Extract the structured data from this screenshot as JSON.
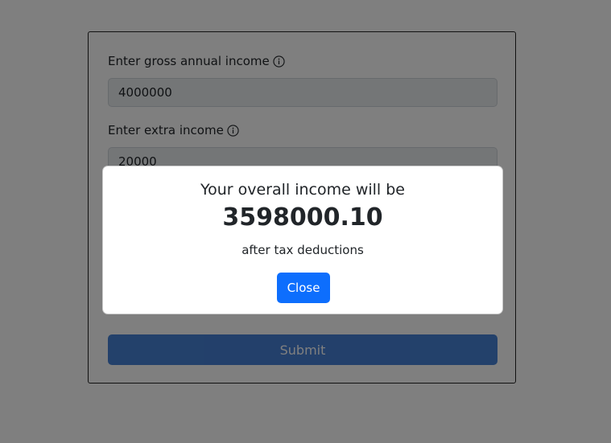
{
  "form": {
    "gross_income_label": "Enter gross annual income",
    "gross_income_value": "4000000",
    "extra_income_label": "Enter extra income",
    "extra_income_value": "20000",
    "submit_label": "Submit"
  },
  "modal": {
    "title": "Your overall income will be",
    "amount": "3598000.10",
    "subtitle": "after tax deductions",
    "close_label": "Close"
  },
  "icons": {
    "info": "info-circle-icon"
  },
  "colors": {
    "primary": "#0d6efd",
    "submit": "#0a58ca",
    "backdrop": "rgba(0,0,0,0.5)"
  }
}
